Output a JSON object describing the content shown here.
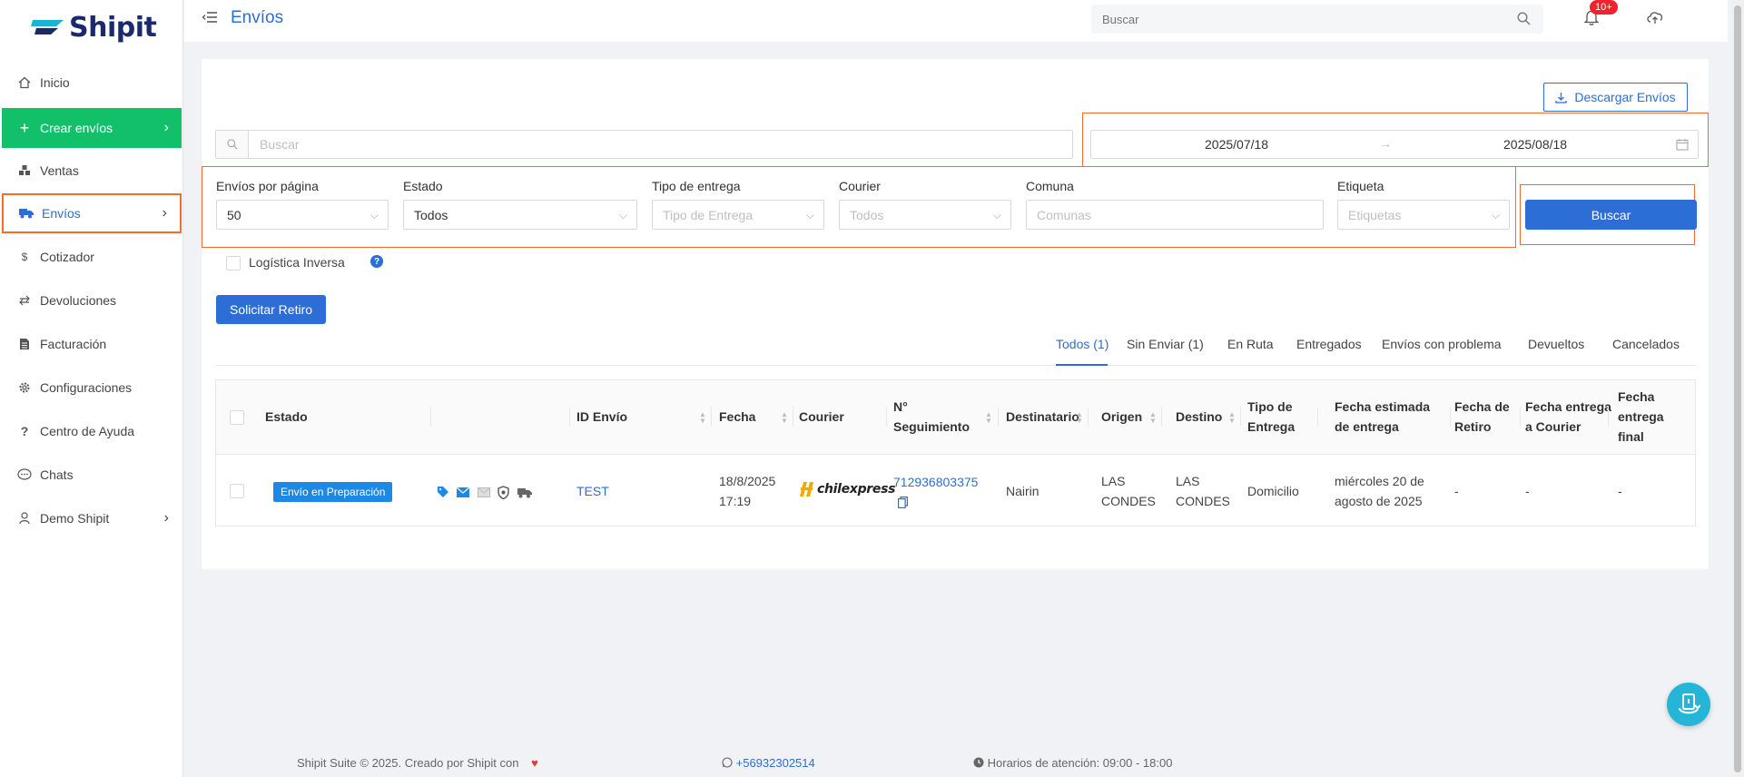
{
  "brand": {
    "name": "Shipit"
  },
  "sidebar": {
    "items": [
      {
        "label": "Inicio",
        "icon": "home-icon"
      },
      {
        "label": "Crear envíos",
        "icon": "plus-icon"
      },
      {
        "label": "Ventas",
        "icon": "boxes-icon"
      },
      {
        "label": "Envíos",
        "icon": "truck-icon"
      },
      {
        "label": "Cotizador",
        "icon": "dollar-icon"
      },
      {
        "label": "Devoluciones",
        "icon": "return-icon"
      },
      {
        "label": "Facturación",
        "icon": "invoice-icon"
      },
      {
        "label": "Configuraciones",
        "icon": "gear-icon"
      },
      {
        "label": "Centro de Ayuda",
        "icon": "question-icon"
      },
      {
        "label": "Chats",
        "icon": "chat-icon"
      },
      {
        "label": "Demo Shipit",
        "icon": "user-icon"
      }
    ]
  },
  "topbar": {
    "title": "Envíos",
    "search_placeholder": "Buscar",
    "notification_badge": "10+"
  },
  "toolbar": {
    "download_label": "Descargar Envíos",
    "search_placeholder": "Buscar",
    "date_from": "2025/07/18",
    "date_to": "2025/08/18",
    "date_separator": "→"
  },
  "filters": {
    "per_page": {
      "label": "Envíos por página",
      "value": "50"
    },
    "estado": {
      "label": "Estado",
      "value": "Todos"
    },
    "tipo_entrega": {
      "label": "Tipo de entrega",
      "placeholder": "Tipo de Entrega"
    },
    "courier": {
      "label": "Courier",
      "placeholder": "Todos"
    },
    "comuna": {
      "label": "Comuna",
      "placeholder": "Comunas"
    },
    "etiqueta": {
      "label": "Etiqueta",
      "placeholder": "Etiquetas"
    },
    "search_button": "Buscar",
    "inverse_logistics": "Logística Inversa"
  },
  "actions": {
    "request_pickup": "Solicitar Retiro"
  },
  "tabs": [
    {
      "label": "Todos (1)",
      "active": true
    },
    {
      "label": "Sin Enviar (1)",
      "active": false
    },
    {
      "label": "En Ruta",
      "active": false
    },
    {
      "label": "Entregados",
      "active": false
    },
    {
      "label": "Envíos con problema",
      "active": false
    },
    {
      "label": "Devueltos",
      "active": false
    },
    {
      "label": "Cancelados",
      "active": false
    }
  ],
  "table": {
    "columns": {
      "estado": "Estado",
      "id": "ID Envío",
      "fecha": "Fecha",
      "courier": "Courier",
      "seguimiento_1": "N°",
      "seguimiento_2": "Seguimiento",
      "destinatario": "Destinatario",
      "origen": "Origen",
      "destino": "Destino",
      "tipo_1": "Tipo de",
      "tipo_2": "Entrega",
      "estimada_1": "Fecha estimada",
      "estimada_2": "de entrega",
      "retiro_1": "Fecha de",
      "retiro_2": "Retiro",
      "courier_entrega_1": "Fecha entrega",
      "courier_entrega_2": "a Courier",
      "final_1": "Fecha",
      "final_2": "entrega",
      "final_3": "final"
    },
    "rows": [
      {
        "status": "Envío en Preparación",
        "id": "TEST",
        "date_1": "18/8/2025",
        "date_2": "17:19",
        "courier": "chilexpress",
        "tracking": "712936803375",
        "recipient": "Nairin",
        "origin_1": "LAS",
        "origin_2": "CONDES",
        "dest_1": "LAS",
        "dest_2": "CONDES",
        "delivery_type": "Domicilio",
        "estimated_1": "miércoles 20 de",
        "estimated_2": "agosto de 2025",
        "pickup_date": "-",
        "courier_date": "-",
        "final_date": "-"
      }
    ]
  },
  "footer": {
    "credit": "Shipit Suite © 2025. Creado por Shipit con",
    "phone": "+56932302514",
    "hours": "Horarios de atención: 09:00 - 18:00"
  },
  "colors": {
    "primary": "#2c6ed5",
    "create_green": "#12c06a",
    "highlight_orange": "#f06d2a",
    "status_blue": "#1e88e5",
    "heart_red": "#e53935",
    "fab_cyan": "#25b5d6"
  }
}
